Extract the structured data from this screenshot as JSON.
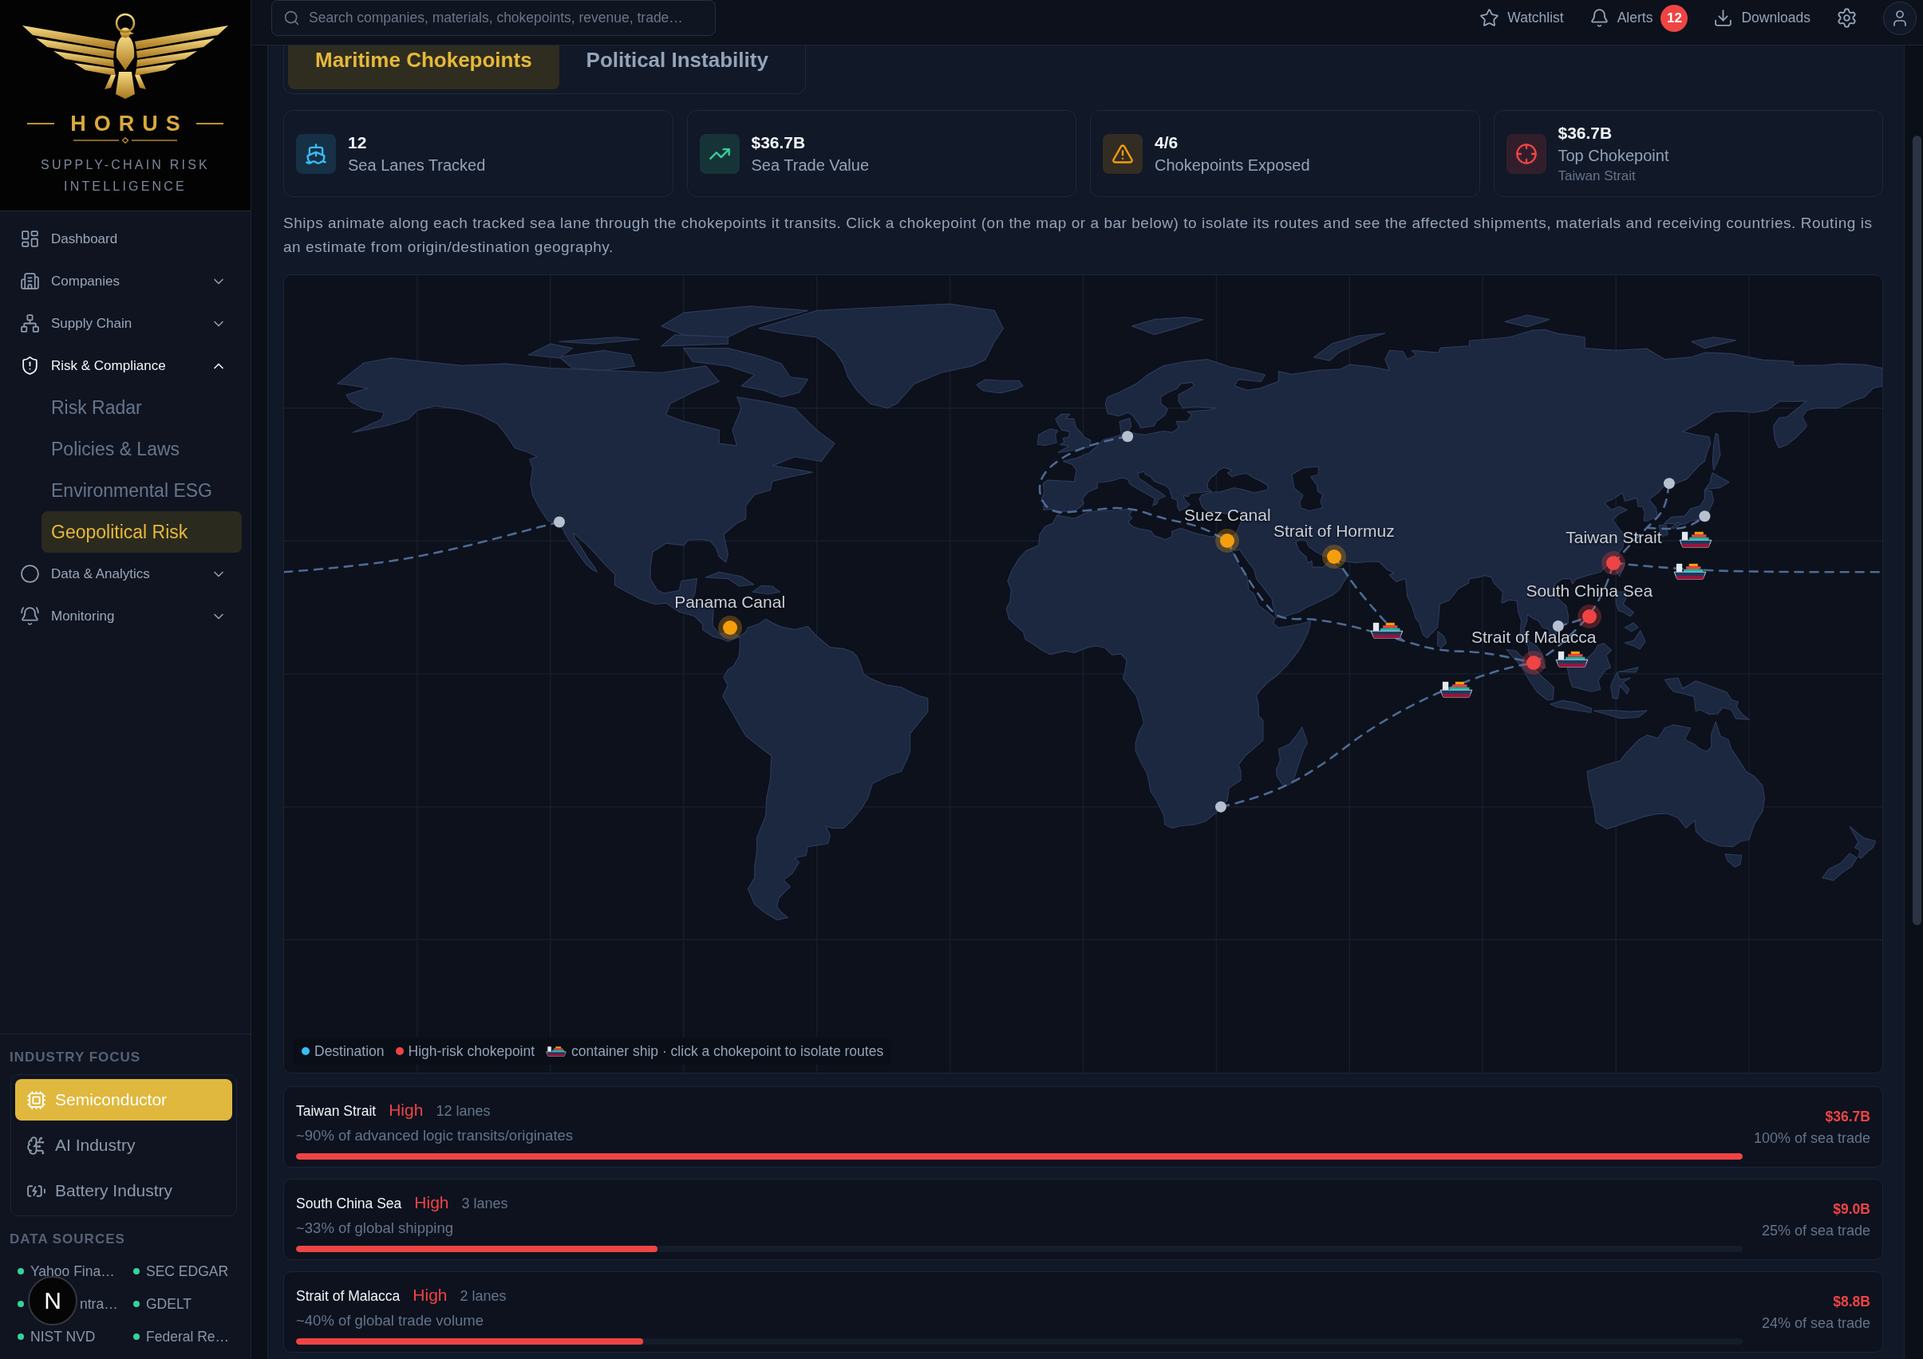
{
  "sidebar": {
    "logo": {
      "wordmark": "HORUS",
      "tagline": "SUPPLY-CHAIN RISK INTELLIGENCE"
    },
    "nav": [
      {
        "label": "Dashboard",
        "kind": "link"
      },
      {
        "label": "Companies",
        "kind": "group",
        "expanded": false
      },
      {
        "label": "Supply Chain",
        "kind": "group",
        "expanded": false
      },
      {
        "label": "Risk & Compliance",
        "kind": "group",
        "expanded": true,
        "children": [
          {
            "label": "Risk Radar",
            "selected": false
          },
          {
            "label": "Policies & Laws",
            "selected": false
          },
          {
            "label": "Environmental ESG",
            "selected": false
          },
          {
            "label": "Geopolitical Risk",
            "selected": true
          }
        ]
      },
      {
        "label": "Data & Analytics",
        "kind": "group",
        "expanded": false
      },
      {
        "label": "Monitoring",
        "kind": "group",
        "expanded": false
      }
    ],
    "industry_focus": {
      "heading": "INDUSTRY FOCUS",
      "options": [
        {
          "label": "Semiconductor",
          "selected": true
        },
        {
          "label": "AI Industry",
          "selected": false
        },
        {
          "label": "Battery Industry",
          "selected": false
        }
      ]
    },
    "data_sources": {
      "heading": "DATA SOURCES",
      "items": [
        {
          "label": "Yahoo Fina…",
          "kind": "source"
        },
        {
          "label": "SEC EDGAR",
          "kind": "source"
        },
        {
          "label": "ntra…",
          "kind": "covered"
        },
        {
          "label": "GDELT",
          "kind": "source"
        },
        {
          "label": "NIST NVD",
          "kind": "source"
        },
        {
          "label": "Federal Re…",
          "kind": "source"
        }
      ]
    }
  },
  "dev_badge": {
    "label": "N"
  },
  "top_bar": {
    "search": {
      "placeholder": "Search companies, materials, chokepoints, revenue, trade…"
    },
    "actions": [
      {
        "label": "Watchlist",
        "kind": "watchlist"
      },
      {
        "label": "Alerts",
        "kind": "alerts",
        "badge": "12"
      },
      {
        "label": "Downloads",
        "kind": "downloads"
      }
    ]
  },
  "tabs": [
    {
      "label": "Maritime Chokepoints",
      "selected": true
    },
    {
      "label": "Political Instability",
      "selected": false
    }
  ],
  "stats": [
    {
      "value": "12",
      "label": "Sea Lanes Tracked",
      "kind": "ship",
      "color": "#38bdf8"
    },
    {
      "value": "$36.7B",
      "label": "Sea Trade Value",
      "kind": "trend",
      "color": "#34d399"
    },
    {
      "value": "4/6",
      "label": "Chokepoints Exposed",
      "kind": "warning",
      "color": "#f59e0b"
    },
    {
      "value": "$36.7B",
      "label": "Top Chokepoint",
      "sub": "Taiwan Strait",
      "kind": "target",
      "color": "#ef4444"
    }
  ],
  "description": "Ships animate along each tracked sea lane through the chokepoints it transits. Click a chokepoint (on the map or a bar below) to isolate its routes and see the affected shipments, materials and receiving countries. Routing is an estimate from origin/destination geography.",
  "map": {
    "chokepoints": [
      {
        "name": "Suez Canal",
        "color": "#f59e0b"
      },
      {
        "name": "Strait of Hormuz",
        "color": "#f59e0b"
      },
      {
        "name": "Taiwan Strait",
        "color": "#ef4444"
      },
      {
        "name": "South China Sea",
        "color": "#ef4444"
      },
      {
        "name": "Panama Canal",
        "color": "#f59e0b"
      },
      {
        "name": "Strait of Malacca",
        "color": "#ef4444"
      }
    ],
    "legend": [
      {
        "label": "Destination",
        "kind": "dot",
        "color": "#38bdf8"
      },
      {
        "label": "High-risk chokepoint",
        "kind": "dot",
        "color": "#ef4444"
      },
      {
        "label": "container ship · click a chokepoint to isolate routes",
        "kind": "ship"
      }
    ]
  },
  "chokepoint_list": [
    {
      "name": "Taiwan Strait",
      "risk": "High",
      "lanes": "12 lanes",
      "note": "~90% of advanced logic transits/originates",
      "value": "$36.7B",
      "share": "100% of sea trade",
      "level": 1,
      "color": "#ef4444"
    },
    {
      "name": "South China Sea",
      "risk": "High",
      "lanes": "3 lanes",
      "note": "~33% of global shipping",
      "value": "$9.0B",
      "share": "25% of sea trade",
      "level": 0.25,
      "color": "#ef4444"
    },
    {
      "name": "Strait of Malacca",
      "risk": "High",
      "lanes": "2 lanes",
      "note": "~40% of global trade volume",
      "value": "$8.8B",
      "share": "24% of sea trade",
      "level": 0.24,
      "color": "#ef4444"
    }
  ]
}
